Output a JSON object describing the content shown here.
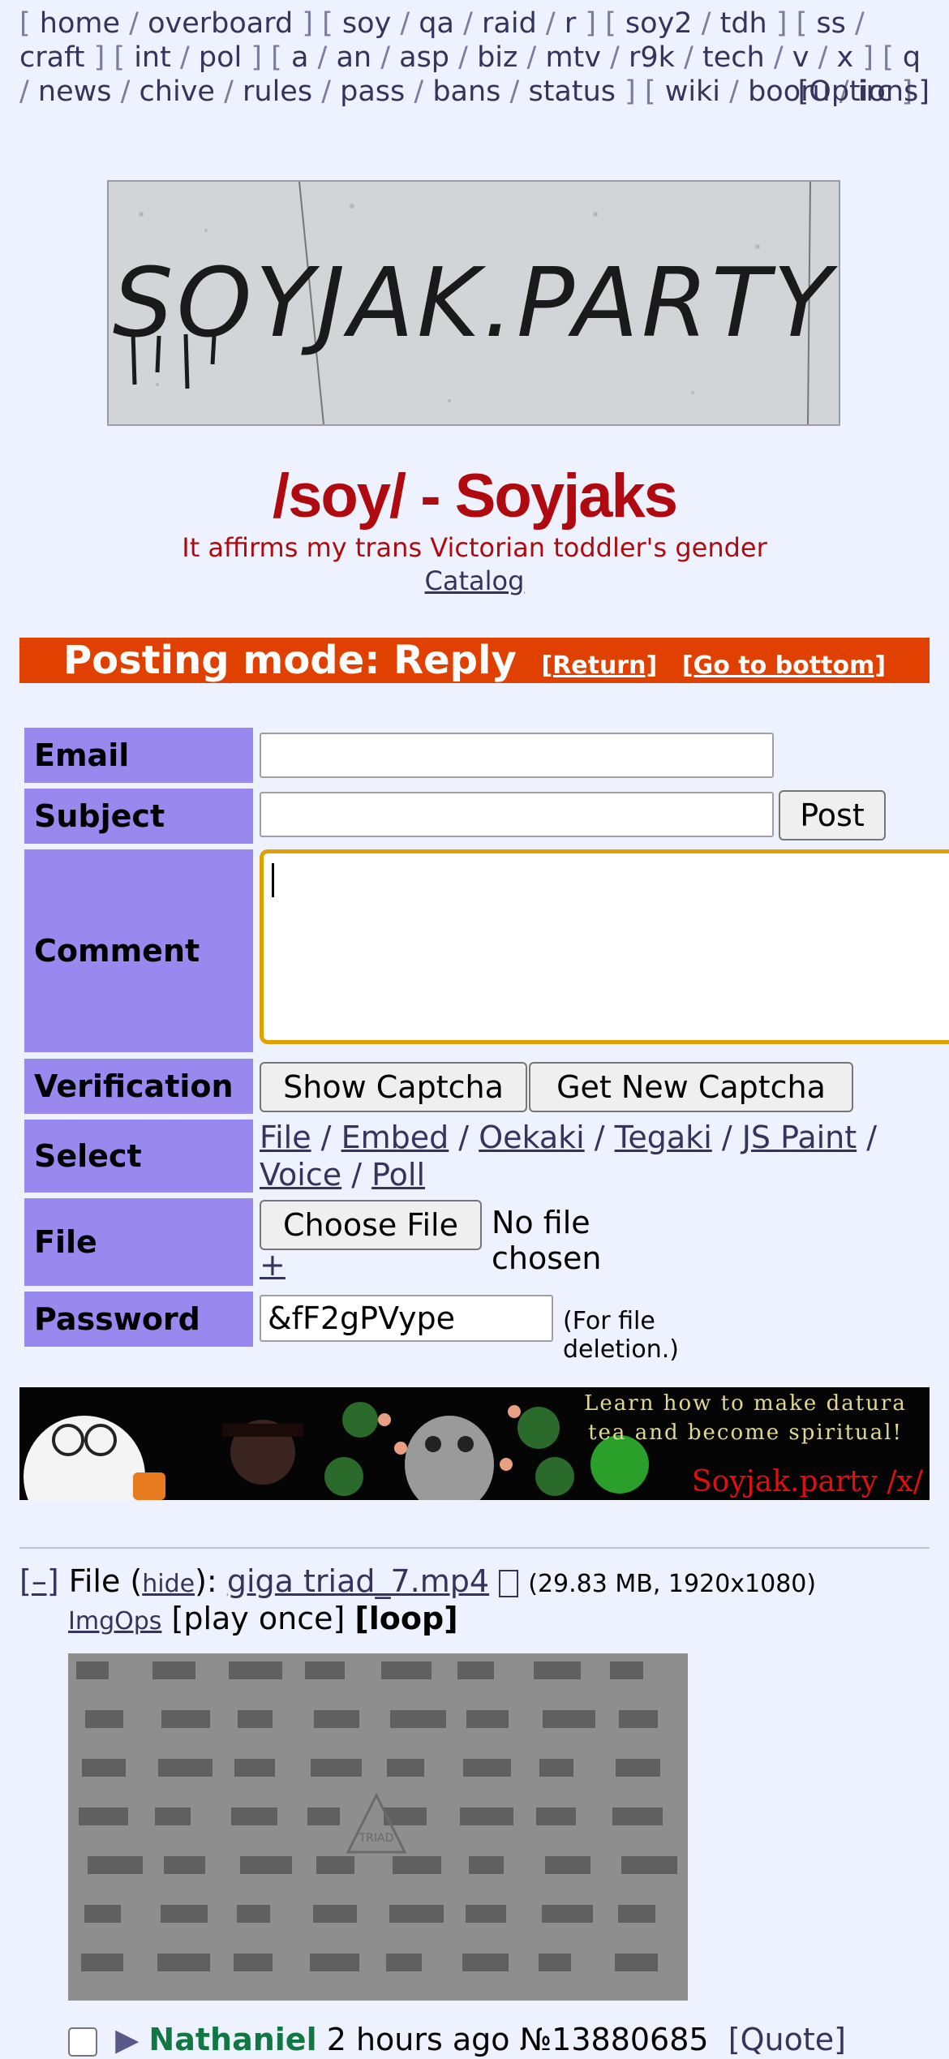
{
  "boardlist": {
    "groups": [
      [
        "home",
        "overboard"
      ],
      [
        "soy",
        "qa",
        "raid",
        "r"
      ],
      [
        "soy2",
        "tdh"
      ],
      [
        "ss",
        "craft"
      ],
      [
        "int",
        "pol"
      ],
      [
        "a",
        "an",
        "asp",
        "biz",
        "mtv",
        "r9k",
        "tech",
        "v",
        "x"
      ],
      [
        "q",
        "news",
        "chive",
        "rules",
        "pass",
        "bans",
        "status"
      ],
      [
        "wiki",
        "booru",
        "irc"
      ]
    ],
    "options_label": "[Options]"
  },
  "banner": {
    "text": "SOYJAK.PARTY"
  },
  "board": {
    "title": "/soy/ - Soyjaks",
    "subtitle": "It affirms my trans Victorian toddler's gender",
    "catalog_link": "Catalog"
  },
  "mode_bar": {
    "label": "Posting mode: Reply",
    "return_link": "[Return]",
    "bottom_link": "[Go to bottom]"
  },
  "form": {
    "email_label": "Email",
    "email_value": "",
    "subject_label": "Subject",
    "subject_value": "",
    "post_button": "Post",
    "comment_label": "Comment",
    "comment_value": "",
    "verification_label": "Verification",
    "show_captcha_button": "Show Captcha",
    "new_captcha_button": "Get New Captcha",
    "select_label": "Select",
    "select_options": [
      "File",
      "Embed",
      "Oekaki",
      "Tegaki",
      "JS Paint",
      "Voice",
      "Poll"
    ],
    "file_label": "File",
    "choose_file_button": "Choose File",
    "no_file_text": "No file chosen",
    "add_file_link": "+",
    "password_label": "Password",
    "password_value": "&fF2gPVype",
    "password_note": "(For file deletion.)"
  },
  "ad": {
    "text": "Learn how to make datura tea and become spiritual!",
    "brand": "Soyjak.party /x/"
  },
  "post": {
    "collapse_toggle": "[–]",
    "file_prefix": "File (",
    "hide_link": "hide",
    "file_mid": "):",
    "filename": "giga triad_7.mp4",
    "file_meta": "(29.83 MB, 1920x1080)",
    "imgops_link": "ImgOps",
    "play_once_label": "[play once]",
    "loop_label": "[loop]",
    "thumb_caption": "TRIAD",
    "name": "Nathaniel",
    "time": "2 hours ago",
    "post_number": "№13880685",
    "quote_link": "[Quote]"
  },
  "colors": {
    "title": "#af0a0f",
    "mode_bar": "#e04000",
    "form_label_bg": "#9988ee",
    "name": "#117743",
    "link": "#34345c",
    "page_bg": "#eef2ff"
  }
}
